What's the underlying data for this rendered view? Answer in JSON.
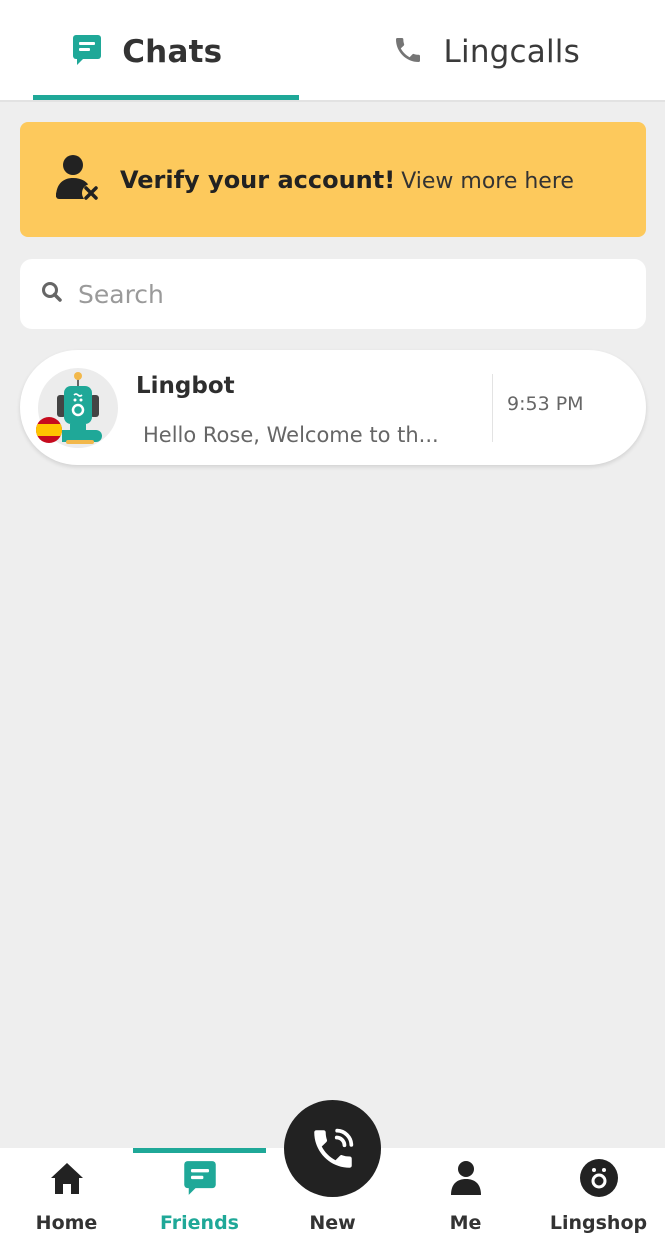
{
  "colors": {
    "accent": "#1fa898",
    "banner": "#fdc95c",
    "background": "#eeeeee",
    "dark": "#222222"
  },
  "top_tabs": [
    {
      "label": "Chats",
      "icon": "chat-bubble-icon",
      "active": true
    },
    {
      "label": "Lingcalls",
      "icon": "phone-icon",
      "active": false
    }
  ],
  "verify_banner": {
    "icon": "user-x-icon",
    "title": "Verify your account!",
    "link": "View more here"
  },
  "search": {
    "icon": "search-icon",
    "placeholder": "Search",
    "value": ""
  },
  "chats": [
    {
      "name": "Lingbot",
      "preview": "Hello Rose,  Welcome to th...",
      "time": "9:53 PM",
      "avatar": "robot-avatar",
      "flag": "spain-flag-icon"
    }
  ],
  "bottom_nav": {
    "items": [
      {
        "label": "Home",
        "icon": "home-icon",
        "active": false
      },
      {
        "label": "Friends",
        "icon": "chat-bubble-icon",
        "active": true
      },
      {
        "label": "New",
        "icon": "phone-call-icon",
        "active": false
      },
      {
        "label": "Me",
        "icon": "person-icon",
        "active": false
      },
      {
        "label": "Lingshop",
        "icon": "lingshop-icon",
        "active": false
      }
    ]
  }
}
